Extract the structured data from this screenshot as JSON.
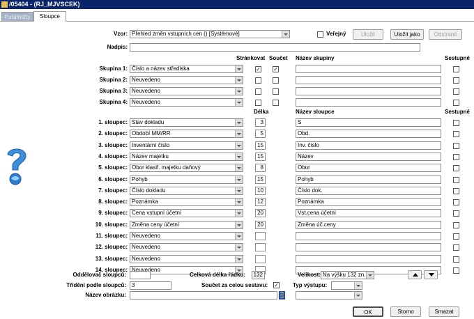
{
  "window": {
    "title": "/05404 - (RJ_MJVSCEK)"
  },
  "tabs": [
    {
      "label": "Parametry"
    },
    {
      "label": "Sloupce"
    }
  ],
  "form": {
    "vzor_label": "Vzor:",
    "vzor_value": "Přehled změn vstupních cen  ()  [Systémové]",
    "verejny_label": "Veřejný",
    "verejny_checked": false,
    "ulozit": "Uložit",
    "ulozit_jako": "Uložit jako",
    "odstranit": "Odstranit",
    "nadpis_label": "Nadpis:",
    "nadpis_value": ""
  },
  "groups": {
    "hdr_strankovat": "Stránkovat",
    "hdr_soucet": "Součet",
    "hdr_nazev": "Název skupiny",
    "hdr_sestupne": "Sestupně",
    "rows": [
      {
        "label": "Skupina 1:",
        "value": "Číslo a název střediska",
        "strankovat": true,
        "soucet": true,
        "name": "",
        "desc": false
      },
      {
        "label": "Skupina 2:",
        "value": "Neuvedeno",
        "strankovat": false,
        "soucet": false,
        "name": "",
        "desc": false
      },
      {
        "label": "Skupina 3:",
        "value": "Neuvedeno",
        "strankovat": false,
        "soucet": false,
        "name": "",
        "desc": false
      },
      {
        "label": "Skupina 4:",
        "value": "Neuvedeno",
        "strankovat": false,
        "soucet": false,
        "name": "",
        "desc": false
      }
    ]
  },
  "columns": {
    "hdr_delka": "Délka",
    "hdr_nazev": "Název sloupce",
    "hdr_sestupne": "Sestupně",
    "rows": [
      {
        "label": "1. sloupec:",
        "value": "Stav dokladu",
        "len": "3",
        "name": "S"
      },
      {
        "label": "2. sloupec:",
        "value": "Období MM/RR",
        "len": "5",
        "name": "Obd."
      },
      {
        "label": "3. sloupec:",
        "value": "Inventární číslo",
        "len": "15",
        "name": "Inv. číslo"
      },
      {
        "label": "4. sloupec:",
        "value": "Název majetku",
        "len": "15",
        "name": "Název"
      },
      {
        "label": "5. sloupec:",
        "value": "Obor klasif. majetku daňový",
        "len": "8",
        "name": "Obor"
      },
      {
        "label": "6. sloupec:",
        "value": "Pohyb",
        "len": "15",
        "name": "Pohyb"
      },
      {
        "label": "7. sloupec:",
        "value": "Číslo dokladu",
        "len": "10",
        "name": "Číslo dok."
      },
      {
        "label": "8. sloupec:",
        "value": "Poznámka",
        "len": "12",
        "name": "Poznámka"
      },
      {
        "label": "9. sloupec:",
        "value": "Cena vstupní účetní",
        "len": "20",
        "name": "Vst.cena účetní"
      },
      {
        "label": "10. sloupec:",
        "value": "Změna ceny účetní",
        "len": "20",
        "name": "Změna úč.ceny"
      },
      {
        "label": "11. sloupec:",
        "value": "Neuvedeno",
        "len": "",
        "name": ""
      },
      {
        "label": "12. sloupec:",
        "value": "Neuvedeno",
        "len": "",
        "name": ""
      },
      {
        "label": "13. sloupec:",
        "value": "Neuvedeno",
        "len": "",
        "name": ""
      },
      {
        "label": "14. sloupec:",
        "value": "Neuvedeno",
        "len": "",
        "name": ""
      }
    ]
  },
  "bottom": {
    "oddelovac_label": "Oddělovač sloupců:",
    "oddelovac_value": "",
    "celkova_label": "Celková délka řádku:",
    "celkova_value": "132",
    "velikost_label": "Velikost:",
    "velikost_value": "Na výšku 132 zn.",
    "trideni_label": "Třídění podle sloupců:",
    "trideni_value": "3",
    "soucet_label": "Součet za celou sestavu:",
    "soucet_checked": true,
    "typ_label": "Typ výstupu:",
    "typ_value": "",
    "obrazek_label": "Název obrázku:",
    "obrazek_value": "",
    "obrazek_combo": "",
    "ok": "OK",
    "storno": "Storno",
    "smazat": "Smazat"
  }
}
